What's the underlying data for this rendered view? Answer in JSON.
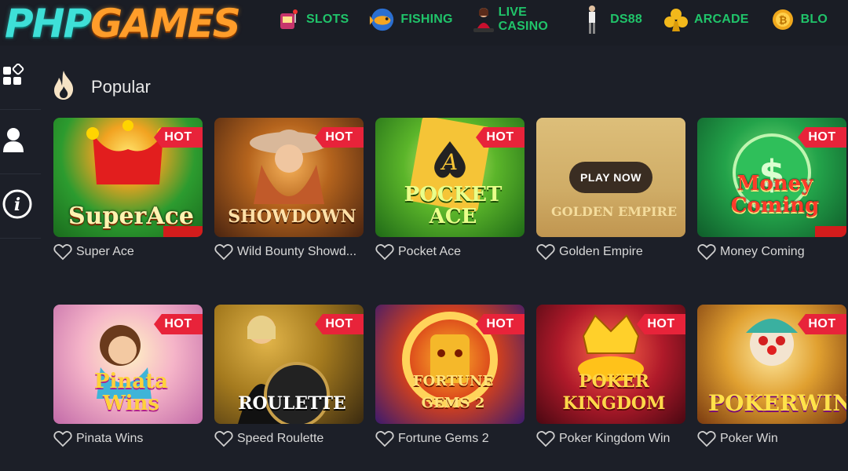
{
  "header": {
    "logo_php": "PHP",
    "logo_games": "GAMES",
    "nav": [
      {
        "label": "SLOTS",
        "icon": "slot-machine-icon"
      },
      {
        "label": "FISHING",
        "icon": "fish-icon"
      },
      {
        "label": "LIVE CASINO",
        "icon": "dealer-icon"
      },
      {
        "label": "DS88",
        "icon": "rooster-icon"
      },
      {
        "label": "ARCADE",
        "icon": "club-icon"
      },
      {
        "label": "BLO",
        "icon": "coin-icon"
      }
    ]
  },
  "sidebar": {
    "items": [
      {
        "icon": "apps-grid-icon"
      },
      {
        "icon": "user-icon"
      },
      {
        "icon": "info-icon"
      }
    ]
  },
  "section": {
    "title": "Popular",
    "icon": "flame-icon"
  },
  "badge_label": "HOT",
  "play_now_label": "PLAY NOW",
  "games": [
    {
      "name": "Super Ace",
      "art_title": "SuperAce",
      "hot": true
    },
    {
      "name": "Wild Bounty Showd...",
      "art_title": "SHOWDOWN",
      "hot": true
    },
    {
      "name": "Pocket Ace",
      "art_title": "POCKET ACE",
      "hot": true
    },
    {
      "name": "Golden Empire",
      "art_title": "GOLDEN EMPIRE",
      "hot": false
    },
    {
      "name": "Money Coming",
      "art_title": "Money Coming",
      "hot": true
    },
    {
      "name": "Pinata Wins",
      "art_title": "Pinata Wins",
      "hot": true
    },
    {
      "name": "Speed Roulette",
      "art_title": "ROULETTE",
      "hot": true
    },
    {
      "name": "Fortune Gems 2",
      "art_title": "FORTUNE GEMS 2",
      "hot": true
    },
    {
      "name": "Poker Kingdom Win",
      "art_title": "POKER KINGDOM",
      "hot": true
    },
    {
      "name": "Poker Win",
      "art_title": "POKERWIN",
      "hot": true
    }
  ],
  "colors": {
    "nav_text": "#20c46a",
    "hot_badge": "#e8233a",
    "background": "#1c1f28"
  }
}
